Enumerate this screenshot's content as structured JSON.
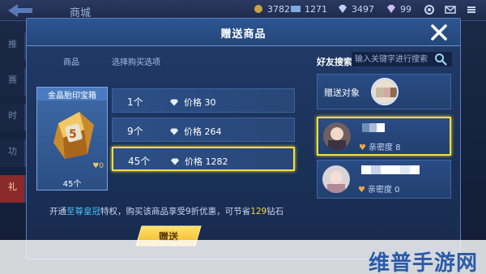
{
  "background": {
    "shop_title": "商城",
    "resources": [
      "3782",
      "1271",
      "3497",
      "99"
    ],
    "left_tabs": [
      "推",
      "赛",
      "时",
      "功",
      "礼"
    ]
  },
  "modal": {
    "title": "赠送商品",
    "tabs": [
      "商品",
      "选择购买选项"
    ]
  },
  "item": {
    "name": "金晶胎印宝箱",
    "count": "45个",
    "badge_icon": "heart-icon"
  },
  "options": [
    {
      "qty": "1个",
      "price_label": "价格",
      "price": "30"
    },
    {
      "qty": "9个",
      "price_label": "价格",
      "price": "264"
    },
    {
      "qty": "45个",
      "price_label": "价格",
      "price": "1282"
    }
  ],
  "promo": {
    "part1": "开通",
    "highlight": "至尊皇冠",
    "part2": "特权，购买该商品享受9折优惠，可节省",
    "saving": "129",
    "part3": "钻石"
  },
  "gift_button": "赠送",
  "friends": {
    "search_label": "好友搜索",
    "search_placeholder": "输入关键字进行搜索",
    "target_label": "赠送对象",
    "list": [
      {
        "intimacy": "亲密度 8"
      },
      {
        "intimacy": "亲密度 0"
      }
    ]
  },
  "watermark": "维普手游网",
  "colors": {
    "accent_yellow": "#f2dd3c",
    "highlight_blue": "#47c1ff",
    "highlight_gold": "#f7d046"
  }
}
